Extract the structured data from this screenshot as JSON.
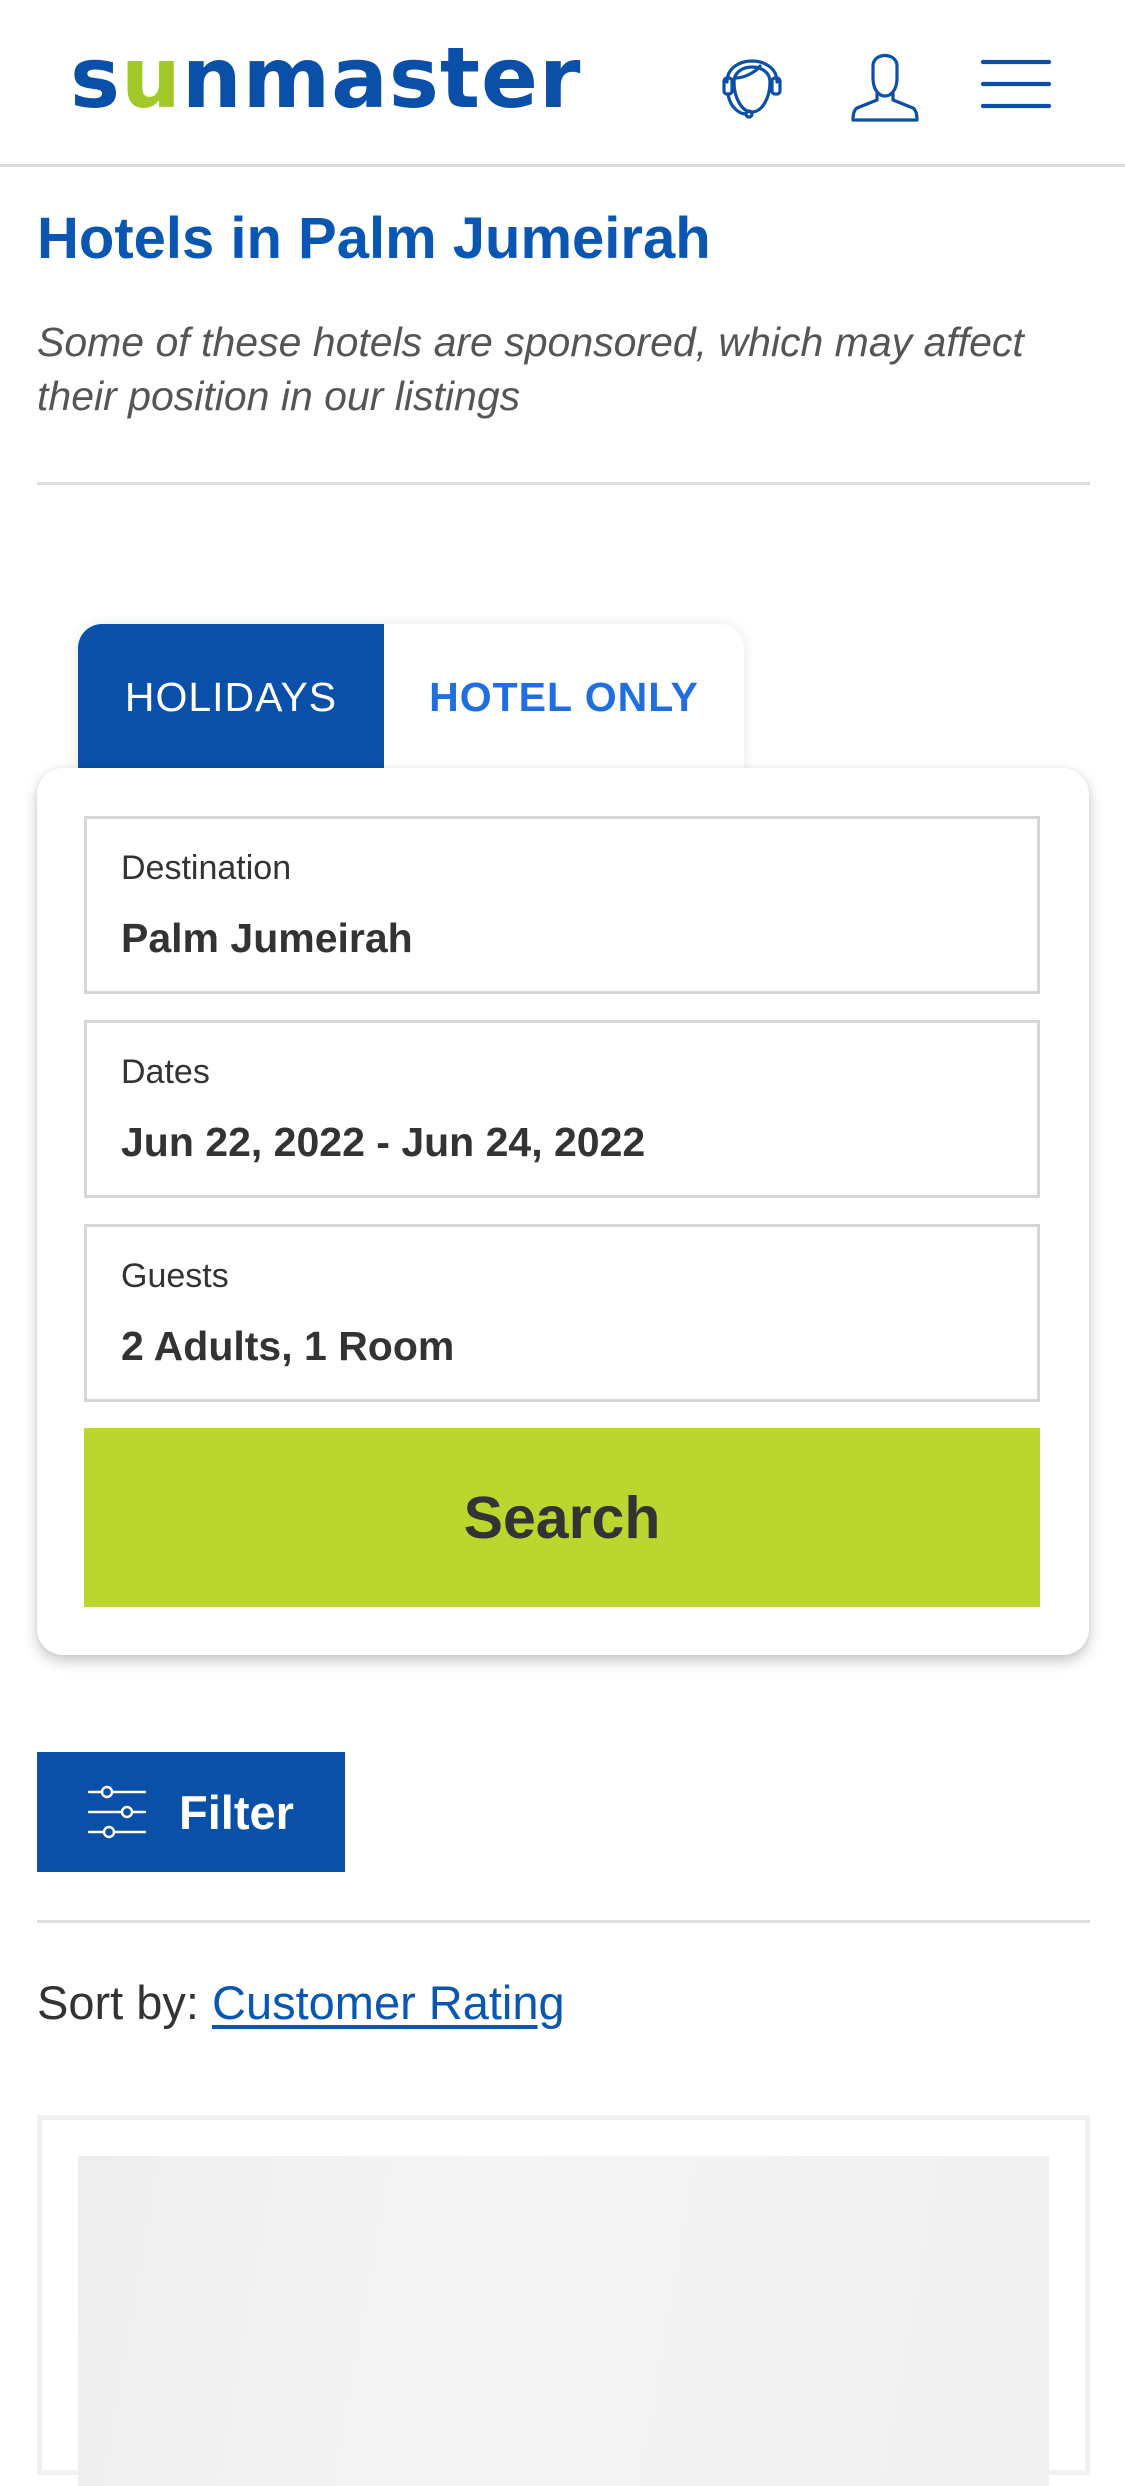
{
  "header": {
    "logo": {
      "prefix": "s",
      "accent": "u",
      "suffix": "nmaster"
    },
    "support_icon": "headset-icon",
    "account_icon": "user-icon",
    "menu_icon": "hamburger-menu-icon"
  },
  "page": {
    "title": "Hotels in Palm Jumeirah",
    "sponsor_note": "Some of these hotels are sponsored, which may affect their position in our listings"
  },
  "search_tabs": [
    {
      "label": "HOLIDAYS",
      "active": true
    },
    {
      "label": "HOTEL ONLY",
      "active": false
    }
  ],
  "search_form": {
    "destination": {
      "label": "Destination",
      "value": "Palm Jumeirah"
    },
    "dates": {
      "label": "Dates",
      "value": "Jun 22, 2022 - Jun 24, 2022"
    },
    "guests": {
      "label": "Guests",
      "value": "2 Adults, 1 Room"
    },
    "search_label": "Search"
  },
  "filter": {
    "label": "Filter",
    "icon": "sliders-icon"
  },
  "sort": {
    "prefix": "Sort by: ",
    "value": "Customer Rating"
  },
  "colors": {
    "brand_blue": "#0a4fa8",
    "title_blue": "#0a56b3",
    "tab_text_blue": "#1f6fe0",
    "accent_green": "#bcd630",
    "logo_green": "#a3c829"
  }
}
